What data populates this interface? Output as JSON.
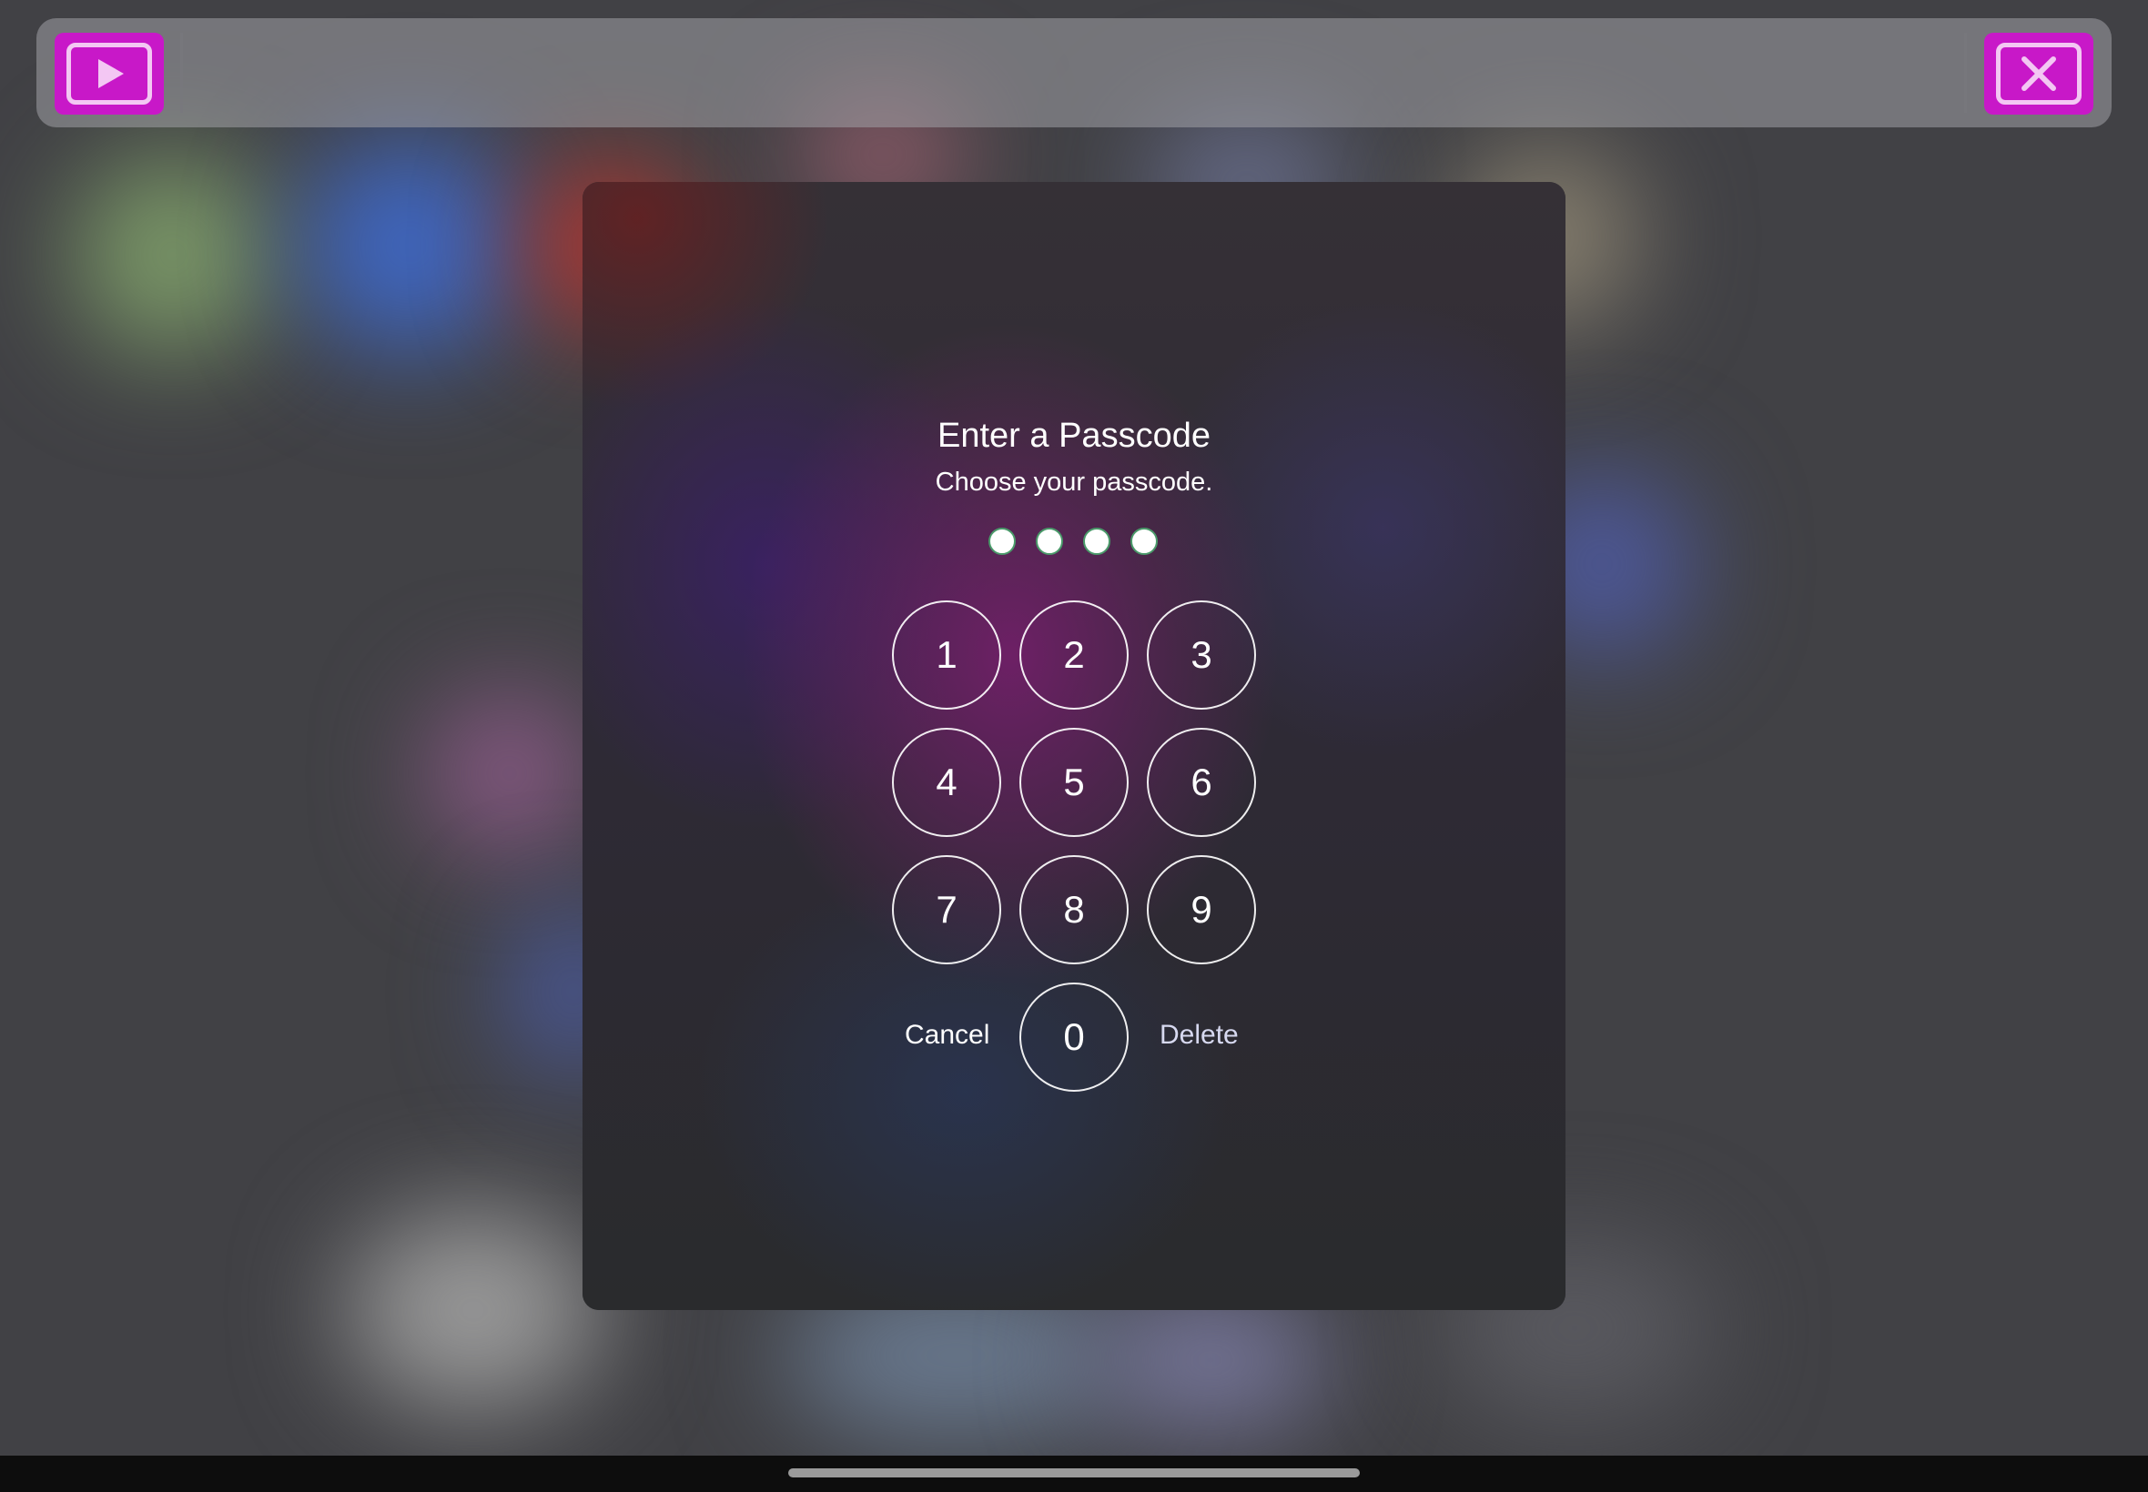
{
  "toolbar": {
    "play_icon": "play-icon",
    "close_icon": "close-icon",
    "accent_color": "#c818c8"
  },
  "dialog": {
    "title": "Enter a Passcode",
    "subtitle": "Choose your passcode.",
    "passcode_length": 4,
    "keys": [
      "1",
      "2",
      "3",
      "4",
      "5",
      "6",
      "7",
      "8",
      "9",
      "0"
    ],
    "cancel_label": "Cancel",
    "delete_label": "Delete"
  }
}
